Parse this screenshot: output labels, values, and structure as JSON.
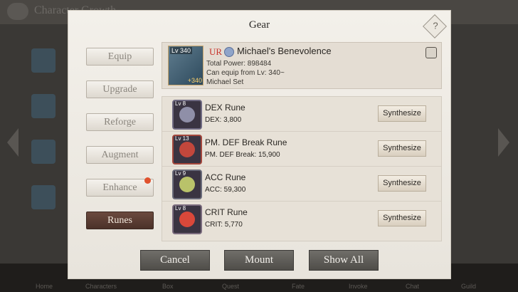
{
  "background": {
    "title": "Character Growth",
    "nav": [
      "Home",
      "Characters",
      "Box",
      "Quest",
      "Fate",
      "Invoke",
      "Chat",
      "Guild"
    ]
  },
  "modal": {
    "title": "Gear",
    "help_icon": "diamond-help-icon"
  },
  "tabs": [
    {
      "label": "Equip",
      "active": false
    },
    {
      "label": "Upgrade",
      "active": false
    },
    {
      "label": "Reforge",
      "active": false
    },
    {
      "label": "Augment",
      "active": false
    },
    {
      "label": "Enhance",
      "active": false
    },
    {
      "label": "Runes",
      "active": true
    }
  ],
  "gear": {
    "level": "Lv 340",
    "plus": "+340",
    "rarity": "UR",
    "name": "Michael's Benevolence",
    "power": "Total Power: 898484",
    "equip_req": "Can equip from Lv: 340~",
    "set": "Michael Set"
  },
  "runes": [
    {
      "level": "Lv 8",
      "name": "DEX Rune",
      "stat": "DEX: 3,800",
      "action": "Synthesize",
      "gem_color": "#8f8fa8",
      "border_color": "#6f6a82"
    },
    {
      "level": "Lv 13",
      "name": "PM. DEF Break Rune",
      "stat": "PM. DEF Break: 15,900",
      "action": "Synthesize",
      "gem_color": "#c2473c",
      "border_color": "#a4473d"
    },
    {
      "level": "Lv 9",
      "name": "ACC Rune",
      "stat": "ACC: 59,300",
      "action": "Synthesize",
      "gem_color": "#b9c26a",
      "border_color": "#6a6b7a"
    },
    {
      "level": "Lv 8",
      "name": "CRIT Rune",
      "stat": "CRIT: 5,770",
      "action": "Synthesize",
      "gem_color": "#d9483a",
      "border_color": "#7a6b7d"
    }
  ],
  "buttons": {
    "cancel": "Cancel",
    "mount": "Mount",
    "show_all": "Show All"
  }
}
